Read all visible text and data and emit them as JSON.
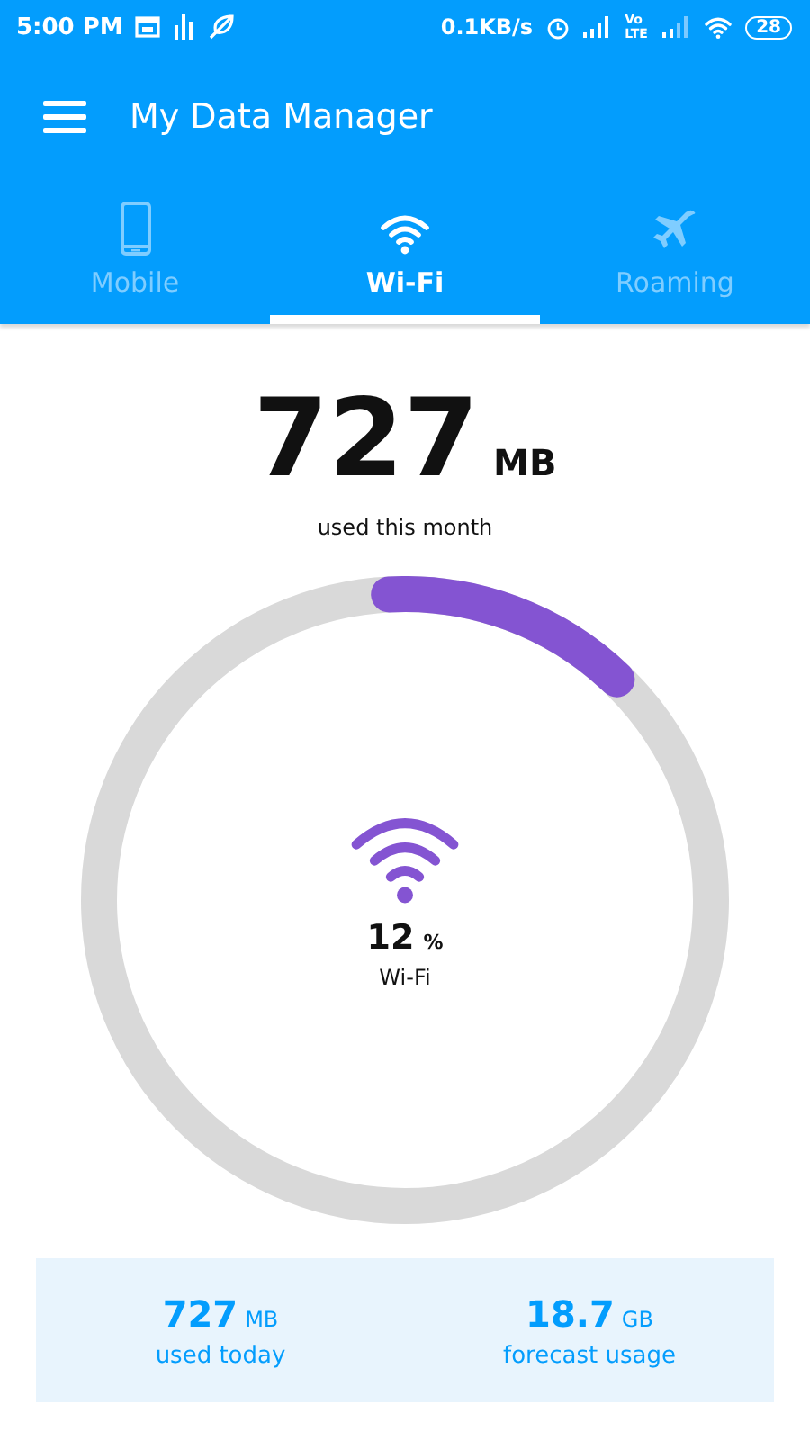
{
  "status_bar": {
    "time": "5:00 PM",
    "speed": "0.1KB/s",
    "network_label": "Vo LTE",
    "battery": "28"
  },
  "app_bar": {
    "title": "My Data Manager"
  },
  "tabs": [
    {
      "label": "Mobile",
      "kind": "phone",
      "selected": false
    },
    {
      "label": "Wi-Fi",
      "kind": "wifi",
      "selected": true
    },
    {
      "label": "Roaming",
      "kind": "plane",
      "selected": false
    }
  ],
  "summary": {
    "value": "727",
    "unit": "MB",
    "caption": "used this month"
  },
  "gauge": {
    "level": 0.13,
    "percent": "12",
    "percent_unit": "%",
    "label": "Wi-Fi"
  },
  "stats": [
    {
      "value": "727",
      "unit": "MB",
      "caption": "used today"
    },
    {
      "value": "18.7",
      "unit": "GB",
      "caption": "forecast usage"
    }
  ]
}
